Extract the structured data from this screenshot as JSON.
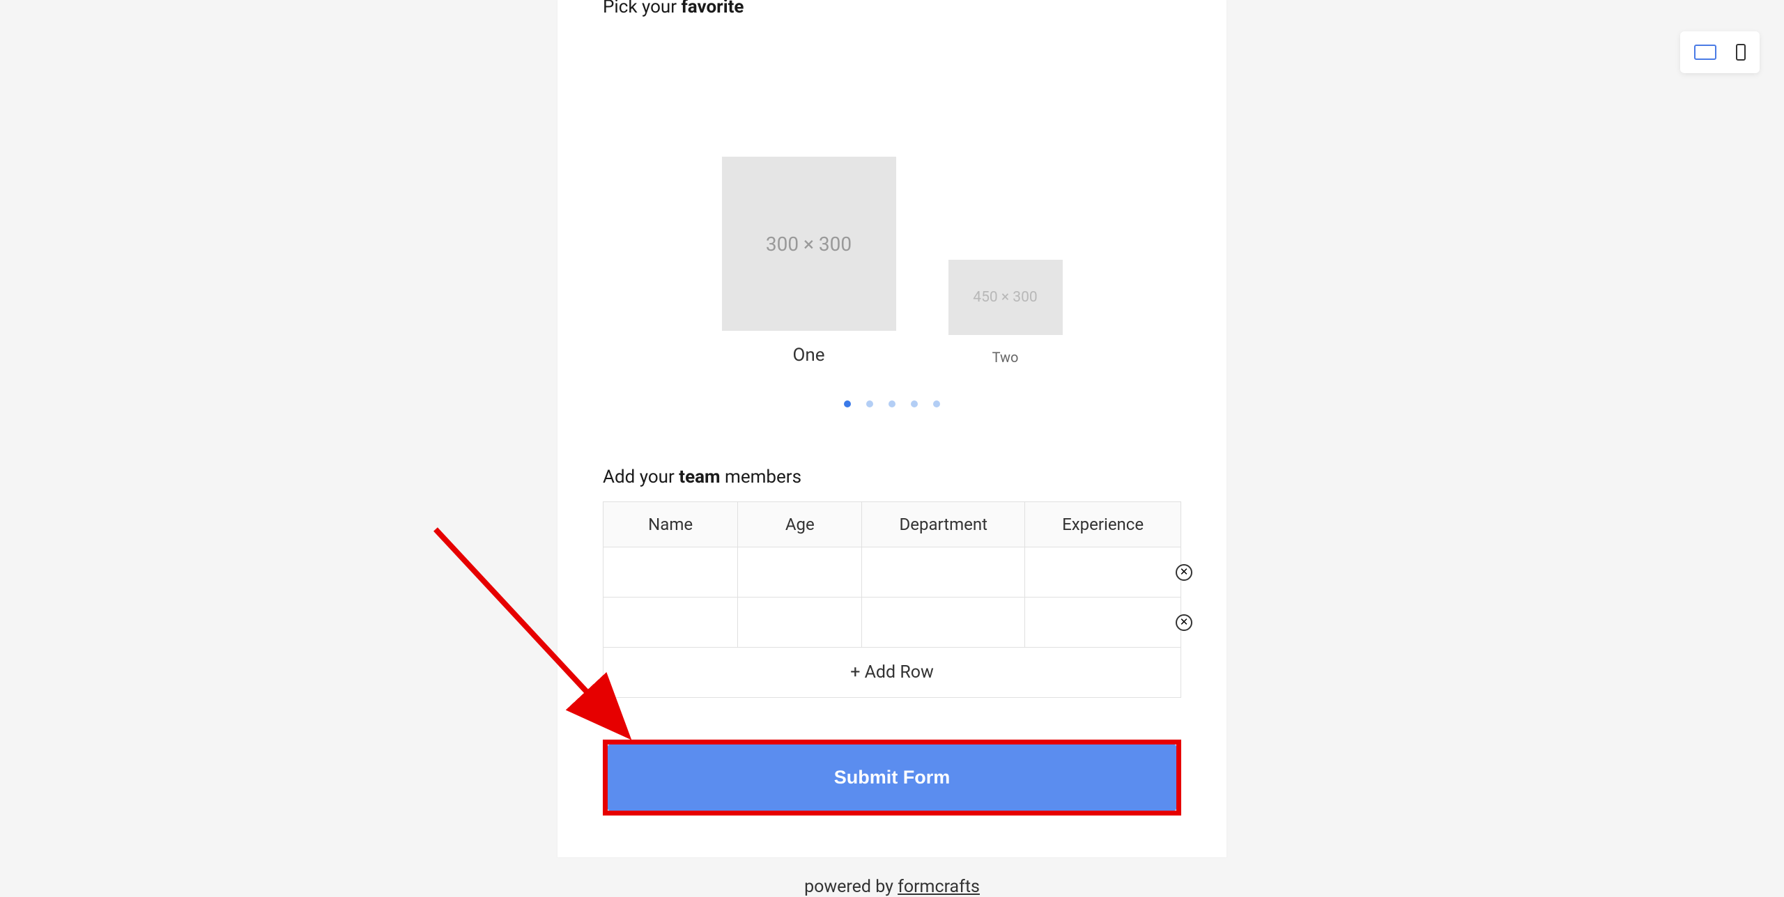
{
  "deviceToggle": {
    "desktop": "desktop",
    "mobile": "mobile"
  },
  "favorite": {
    "label_part1": "Pick your ",
    "label_bold": "favorite",
    "label_part2": "",
    "items": [
      {
        "placeholder": "300 × 300",
        "caption": "One"
      },
      {
        "placeholder": "450 × 300",
        "caption": "Two"
      }
    ],
    "dotCount": 5
  },
  "team": {
    "label_part1": "Add your ",
    "label_bold": "team",
    "label_part2": " members",
    "headers": [
      "Name",
      "Age",
      "Department",
      "Experience"
    ],
    "rows": 2,
    "addRow": "+ Add Row"
  },
  "submit": {
    "label": "Submit Form"
  },
  "footer": {
    "prefix": "powered by ",
    "link": "formcrafts"
  },
  "colors": {
    "accent": "#5b8def",
    "highlight": "#e60000"
  }
}
